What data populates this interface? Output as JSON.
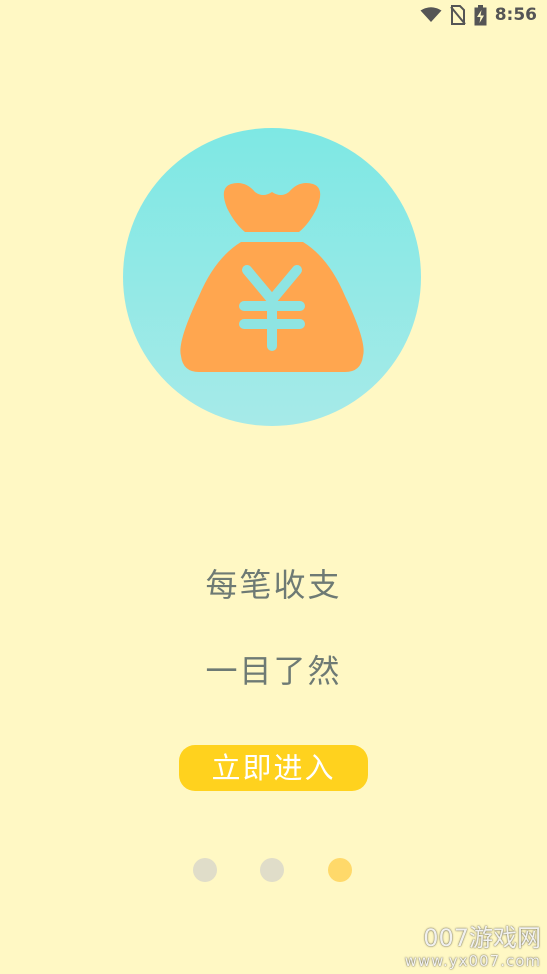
{
  "status_bar": {
    "time": "8:56",
    "icons": [
      "wifi-icon",
      "no-sim-icon",
      "battery-charging-icon"
    ]
  },
  "illustration": {
    "icon": "money-bag-icon",
    "currency_symbol": "¥",
    "circle_colors": [
      "#7EE8E4",
      "#A4EAE9"
    ],
    "bag_color": "#FFA64F",
    "symbol_color": "#8EE4E2"
  },
  "slogan": {
    "line1": "每笔收支",
    "line2": "一目了然"
  },
  "enter_button": {
    "label": "立即进入",
    "color": "#FFD21E"
  },
  "pager": {
    "total": 3,
    "current": 3,
    "inactive_color": "#E0DDC9",
    "active_color": "#FFD96A"
  },
  "watermark": {
    "main": "007游戏网",
    "sub": "www.yx007.com"
  }
}
